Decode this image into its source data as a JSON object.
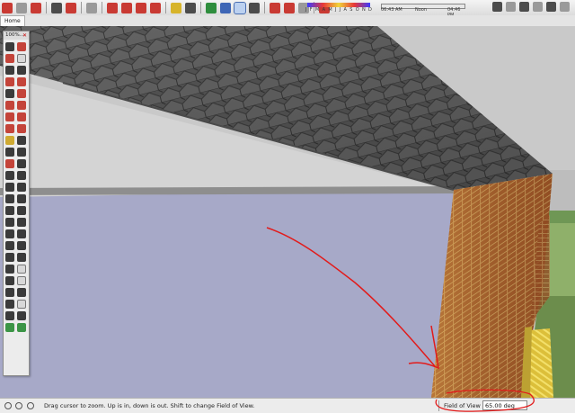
{
  "toolbar": {
    "shadow_months": [
      "J",
      "F",
      "M",
      "A",
      "M",
      "J",
      "J",
      "A",
      "S",
      "O",
      "N",
      "D"
    ],
    "time_start": "06:43 AM",
    "time_noon": "Noon",
    "time_end": "04:46 PM"
  },
  "tab": {
    "label": "Home"
  },
  "palette": {
    "title": "100%...",
    "close": "✕"
  },
  "status": {
    "message": "Drag cursor to zoom.  Up is in, down is out. Shift to change Field of View.",
    "vcb_label": "Field of View",
    "vcb_value": "65.00 deg"
  },
  "colors": {
    "sky": "#c8c8c8",
    "lavender_wall": "#a7a9c8",
    "annotation": "#e21b1b",
    "roof": "#5a5a5a",
    "brick": "#a4602d",
    "grass": "#7aa35b"
  }
}
